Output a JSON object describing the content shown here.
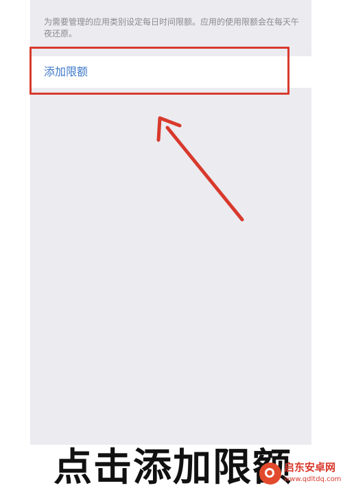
{
  "description": "为需要管理的应用类别设定每日时间限额。应用的使用限额会在每天午夜还原。",
  "add_limit_label": "添加限额",
  "caption": "点击添加限额",
  "watermark": {
    "title": "启东安卓网",
    "url": "www.qdltdq.com"
  },
  "colors": {
    "link_blue": "#3d78c9",
    "annotation_red": "#d8392c",
    "phone_background": "#ebebf0"
  }
}
